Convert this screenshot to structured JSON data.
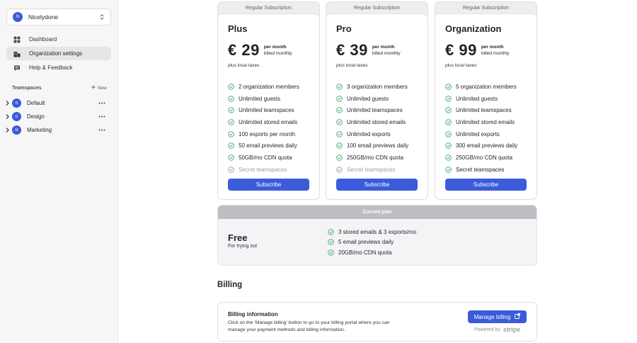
{
  "sidebar": {
    "org": {
      "initial": "N",
      "name": "Nicelydone"
    },
    "nav": [
      {
        "label": "Dashboard",
        "icon": "dashboard-icon",
        "active": false
      },
      {
        "label": "Organization settings",
        "icon": "organization-icon",
        "active": true
      },
      {
        "label": "Help & Feedback",
        "icon": "chat-icon",
        "active": false
      }
    ],
    "teamspaces_title": "Teamspaces",
    "new_label": "New",
    "teamspaces": [
      {
        "initial": "D",
        "name": "Default"
      },
      {
        "initial": "D",
        "name": "Design"
      },
      {
        "initial": "M",
        "name": "Marketing"
      }
    ]
  },
  "plans": [
    {
      "tag": "Regular Subscription",
      "name": "Plus",
      "price": "€ 29",
      "per_month": "per month",
      "billed": "billed monthly",
      "tax": "plus local taxes",
      "features": [
        {
          "text": "2 organization members",
          "enabled": true
        },
        {
          "text": "Unlimited guests",
          "enabled": true
        },
        {
          "text": "Unlimited teamspaces",
          "enabled": true
        },
        {
          "text": "Unlimited stored emails",
          "enabled": true
        },
        {
          "text": "100 exports per month",
          "enabled": true
        },
        {
          "text": "50 email previews daily",
          "enabled": true
        },
        {
          "text": "50GB/mo CDN quota",
          "enabled": true
        },
        {
          "text": "Secret teamspaces",
          "enabled": false
        }
      ],
      "button": "Subscribe"
    },
    {
      "tag": "Regular Subscription",
      "name": "Pro",
      "price": "€ 39",
      "per_month": "per month",
      "billed": "billed monthly",
      "tax": "plus local taxes",
      "features": [
        {
          "text": "3 organization members",
          "enabled": true
        },
        {
          "text": "Unlimited guests",
          "enabled": true
        },
        {
          "text": "Unlimited teamspaces",
          "enabled": true
        },
        {
          "text": "Unlimited stored emails",
          "enabled": true
        },
        {
          "text": "Unlimited exports",
          "enabled": true
        },
        {
          "text": "100 email previews daily",
          "enabled": true
        },
        {
          "text": "250GB/mo CDN quota",
          "enabled": true
        },
        {
          "text": "Secret teamspaces",
          "enabled": false
        }
      ],
      "button": "Subscribe"
    },
    {
      "tag": "Regular Subscription",
      "name": "Organization",
      "price": "€ 99",
      "per_month": "per month",
      "billed": "billed monthly",
      "tax": "plus local taxes",
      "features": [
        {
          "text": "5 organization members",
          "enabled": true
        },
        {
          "text": "Unlimited guests",
          "enabled": true
        },
        {
          "text": "Unlimited teamspaces",
          "enabled": true
        },
        {
          "text": "Unlimited stored emails",
          "enabled": true
        },
        {
          "text": "Unlimited exports",
          "enabled": true
        },
        {
          "text": "300 email previews daily",
          "enabled": true
        },
        {
          "text": "250GB/mo CDN quota",
          "enabled": true
        },
        {
          "text": "Secret teamspaces",
          "enabled": true
        }
      ],
      "button": "Subscribe"
    }
  ],
  "current_plan": {
    "bar_label": "Current plan",
    "name": "Free",
    "subtitle": "For trying out",
    "features": [
      "3 stored emails & 3 exports/mo",
      "5 email previews daily",
      "20GB/mo CDN quota"
    ]
  },
  "billing": {
    "title": "Billing",
    "info_title": "Billing information",
    "info_text": "Click on the 'Manage billing' button to go to your billing portal where you can manage your payment methods and billing information.",
    "manage_button": "Manage billing",
    "powered_by": "Powered by",
    "stripe": "stripe"
  },
  "colors": {
    "accent": "#3b5bdb",
    "check": "#3ca86b",
    "disabled": "#9a9ea5"
  }
}
